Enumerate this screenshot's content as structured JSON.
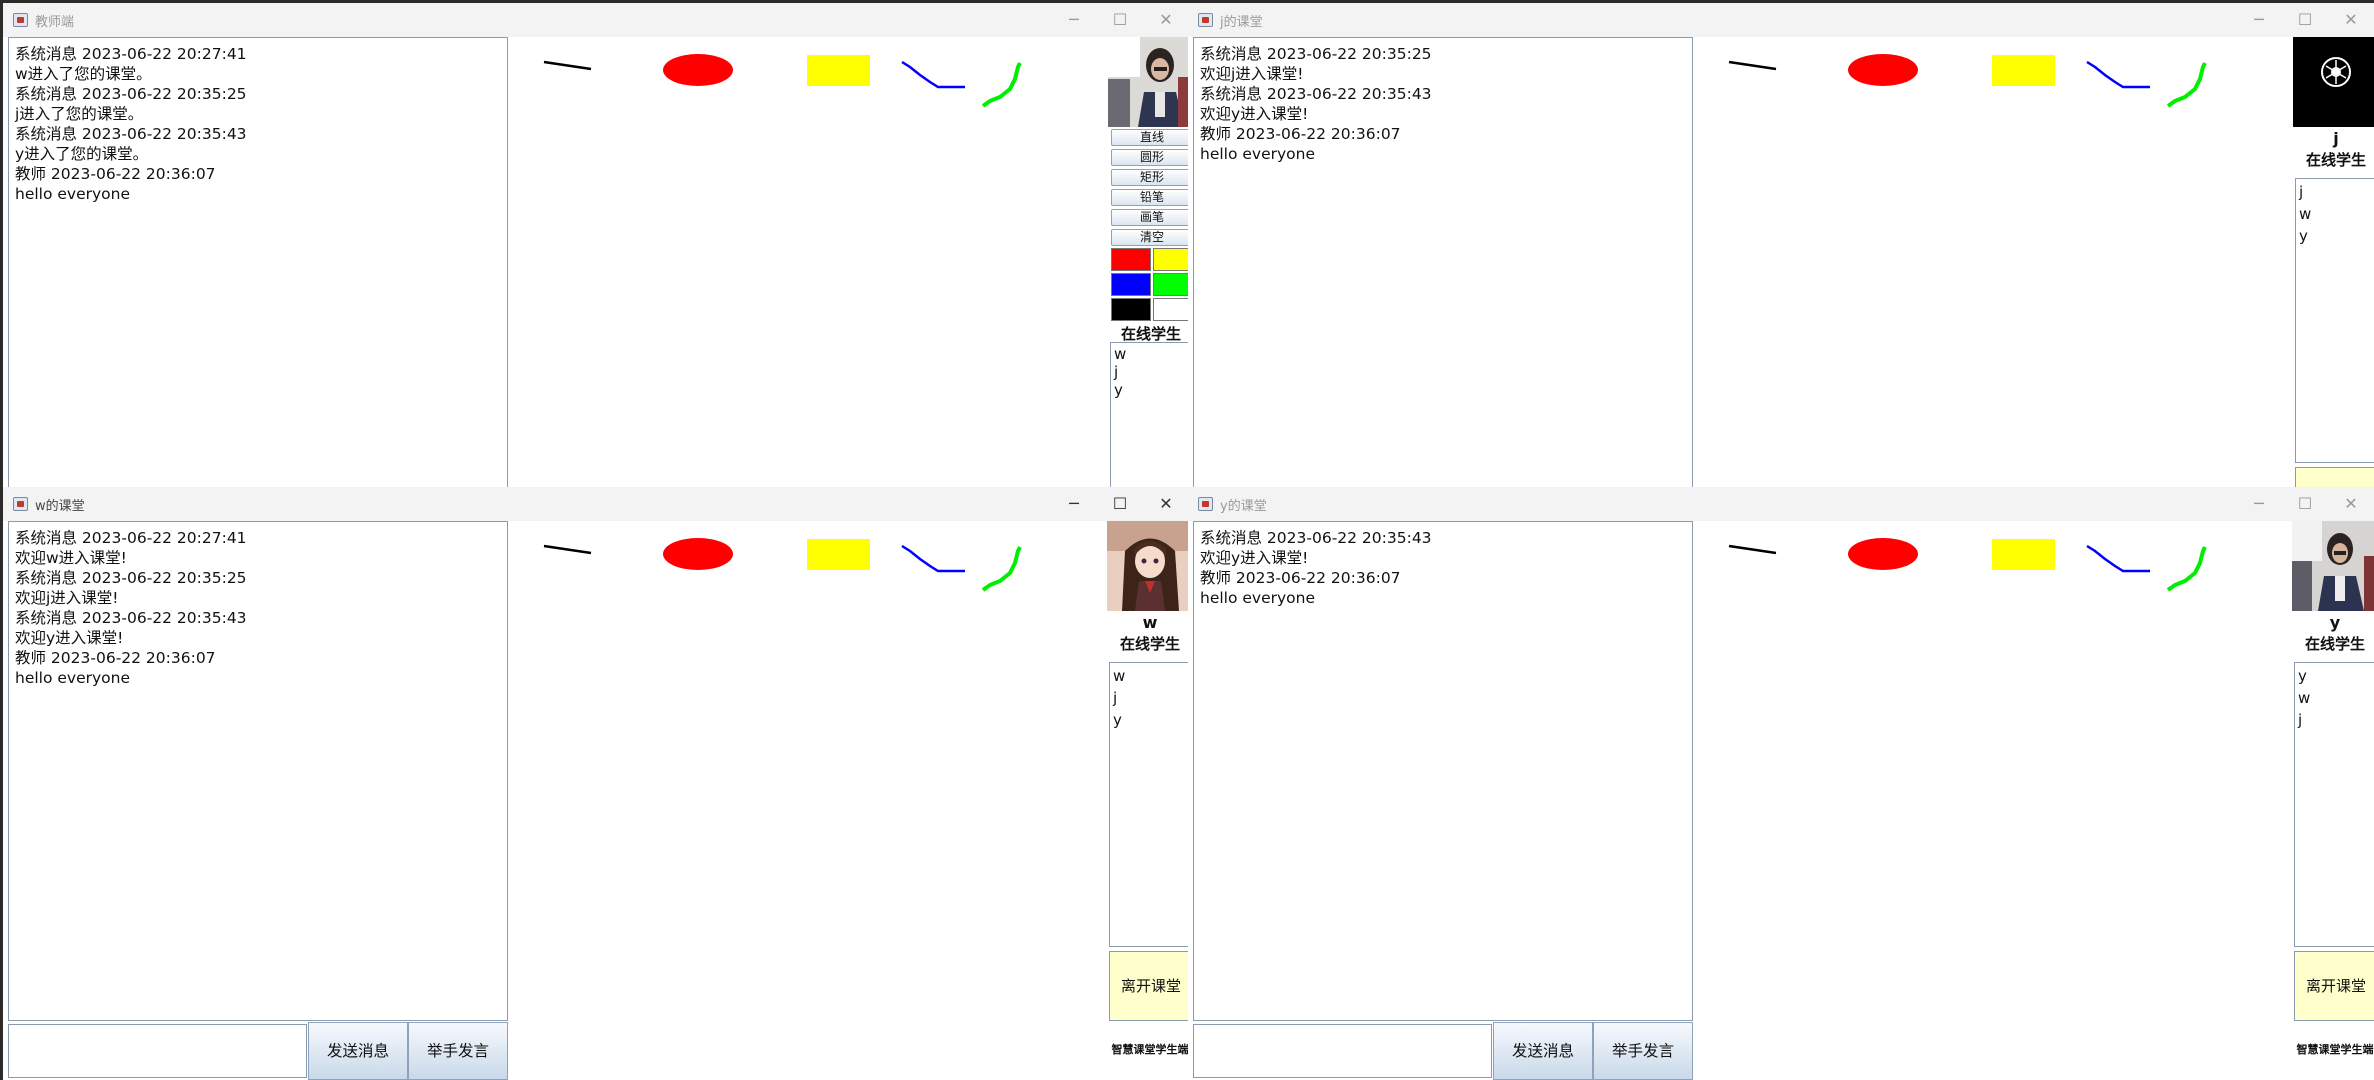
{
  "teacher": {
    "title": "教师端",
    "messages": [
      "系统消息 2023-06-22 20:27:41",
      "w进入了您的课堂。",
      "系统消息 2023-06-22 20:35:25",
      "j进入了您的课堂。",
      "系统消息 2023-06-22 20:35:43",
      "y进入了您的课堂。",
      "教师 2023-06-22 20:36:07",
      "hello everyone"
    ],
    "tools": [
      "直线",
      "圆形",
      "矩形",
      "铅笔",
      "画笔",
      "清空"
    ],
    "palette": [
      "#ff0000",
      "#ffff00",
      "#0000ff",
      "#00ff00",
      "#000000",
      "#ffffff"
    ],
    "online_title": "在线学生",
    "students": [
      "w",
      "j",
      "y"
    ]
  },
  "student_j": {
    "title": "j的课堂",
    "messages": [
      "系统消息 2023-06-22 20:35:25",
      "欢迎j进入课堂!",
      "系统消息 2023-06-22 20:35:43",
      "欢迎y进入课堂!",
      "教师 2023-06-22 20:36:07",
      "hello everyone"
    ],
    "username": "j",
    "online_title": "在线学生",
    "students": [
      "j",
      "w",
      "y"
    ]
  },
  "student_w": {
    "title": "w的课堂",
    "messages": [
      "系统消息 2023-06-22 20:27:41",
      "欢迎w进入课堂!",
      "系统消息 2023-06-22 20:35:25",
      "欢迎j进入课堂!",
      "系统消息 2023-06-22 20:35:43",
      "欢迎y进入课堂!",
      "教师 2023-06-22 20:36:07",
      "hello everyone"
    ],
    "username": "w",
    "online_title": "在线学生",
    "students": [
      "w",
      "j",
      "y"
    ],
    "leave_label": "离开课堂",
    "brand": "智慧课堂学生端",
    "send_label": "发送消息",
    "raise_label": "举手发言",
    "input_value": ""
  },
  "student_y": {
    "title": "y的课堂",
    "messages": [
      "系统消息 2023-06-22 20:35:43",
      "欢迎y进入课堂!",
      "教师 2023-06-22 20:36:07",
      "hello everyone"
    ],
    "username": "y",
    "online_title": "在线学生",
    "students": [
      "y",
      "w",
      "j"
    ],
    "leave_label": "离开课堂",
    "brand": "智慧课堂学生端",
    "send_label": "发送消息",
    "raise_label": "举手发言",
    "input_value": ""
  },
  "window_controls": {
    "minimize": "─",
    "maximize": "☐",
    "close": "✕"
  },
  "drawing": {
    "shapes": [
      {
        "kind": "line",
        "color": "#000000"
      },
      {
        "kind": "ellipse",
        "color": "#ff0000"
      },
      {
        "kind": "rectangle",
        "color": "#ffff00"
      },
      {
        "kind": "pencil-stroke",
        "color": "#0000ff"
      },
      {
        "kind": "brush-stroke",
        "color": "#00ff00"
      }
    ]
  }
}
